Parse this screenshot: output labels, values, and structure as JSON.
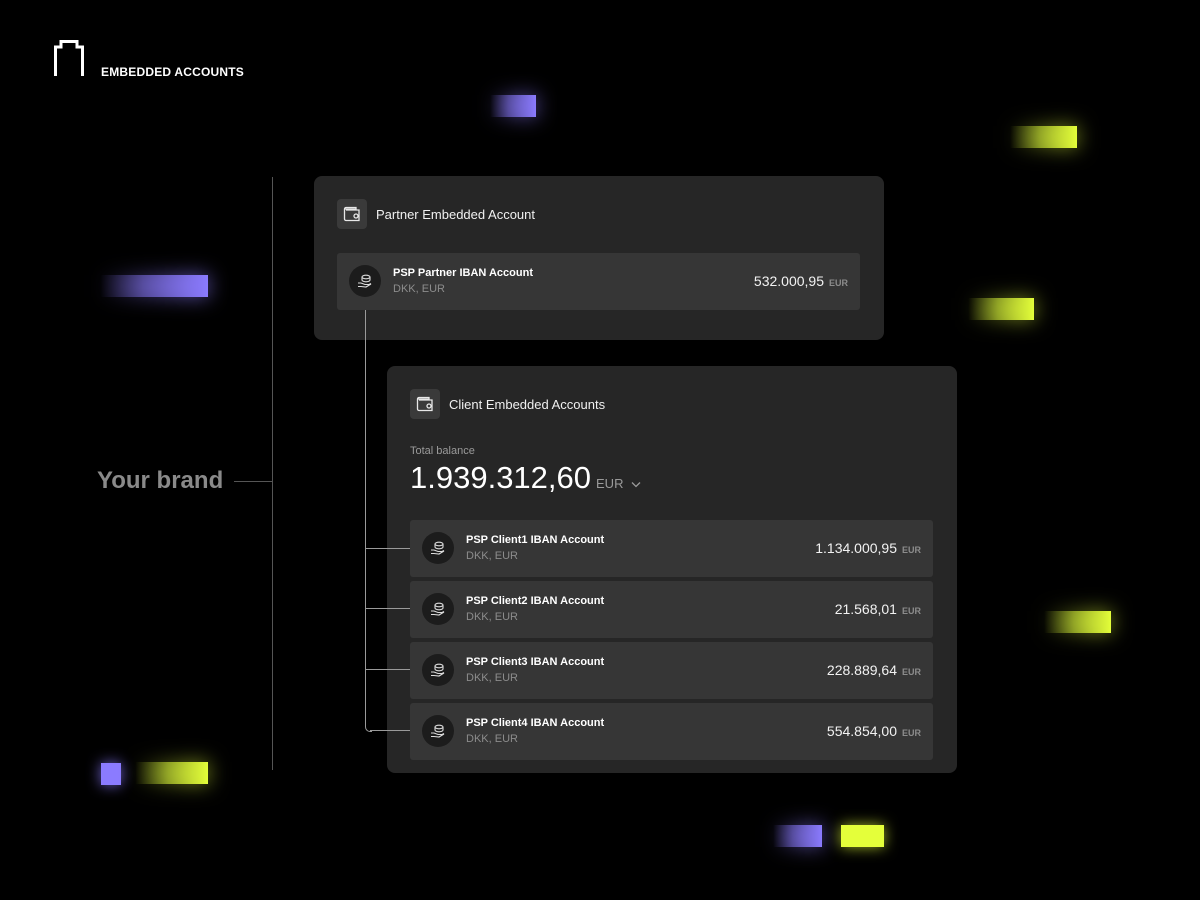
{
  "header": {
    "title": "EMBEDDED ACCOUNTS"
  },
  "side": {
    "brand_label": "Your brand"
  },
  "partner": {
    "title": "Partner Embedded Account",
    "account": {
      "name": "PSP Partner IBAN Account",
      "currencies": "DKK, EUR",
      "balance": "532.000,95",
      "currency": "EUR"
    }
  },
  "clients": {
    "title": "Client Embedded Accounts",
    "total_label": "Total balance",
    "total_value": "1.939.312,60",
    "total_currency": "EUR",
    "accounts": [
      {
        "name": "PSP Client1 IBAN Account",
        "currencies": "DKK, EUR",
        "balance": "1.134.000,95",
        "currency": "EUR"
      },
      {
        "name": "PSP Client2 IBAN Account",
        "currencies": "DKK, EUR",
        "balance": "21.568,01",
        "currency": "EUR"
      },
      {
        "name": "PSP Client3 IBAN Account",
        "currencies": "DKK, EUR",
        "balance": "228.889,64",
        "currency": "EUR"
      },
      {
        "name": "PSP Client4 IBAN Account",
        "currencies": "DKK, EUR",
        "balance": "554.854,00",
        "currency": "EUR"
      }
    ]
  },
  "icons": {
    "logo": "arch-logo-icon",
    "wallet": "wallet-icon",
    "coins": "coins-hand-icon",
    "chevron": "chevron-down-icon"
  },
  "colors": {
    "accent_purple": "#8b7bff",
    "accent_lime": "#e4ff3a",
    "panel": "#262626",
    "row": "#363636"
  }
}
